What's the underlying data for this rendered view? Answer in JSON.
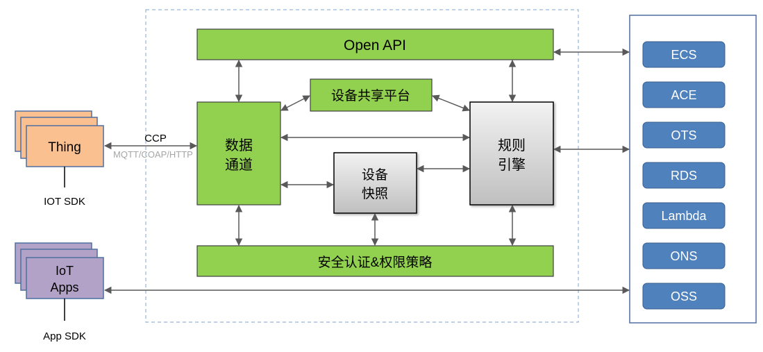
{
  "colors": {
    "green": "#92d050",
    "orange": "#fac090",
    "purple": "#b3a2c7",
    "blue": "#4f81bd",
    "arrow": "#595959"
  },
  "clients": {
    "thing": {
      "label": "Thing",
      "sdk": "IOT SDK"
    },
    "apps": {
      "label_line1": "IoT",
      "label_line2": "Apps",
      "sdk": "App SDK"
    },
    "protocol": {
      "name": "CCP",
      "detail": "MQTT/COAP/HTTP"
    }
  },
  "core": {
    "open_api": "Open API",
    "data_channel": {
      "line1": "数据通道",
      "line1a": "数据",
      "line1b": "通道"
    },
    "device_share": "设备共享平台",
    "device_snapshot": {
      "line1": "设备",
      "line2": "快照"
    },
    "rule_engine": {
      "line1": "规则",
      "line2": "引擎"
    },
    "security": "安全认证&权限策略"
  },
  "services": [
    "ECS",
    "ACE",
    "OTS",
    "RDS",
    "Lambda",
    "ONS",
    "OSS"
  ]
}
